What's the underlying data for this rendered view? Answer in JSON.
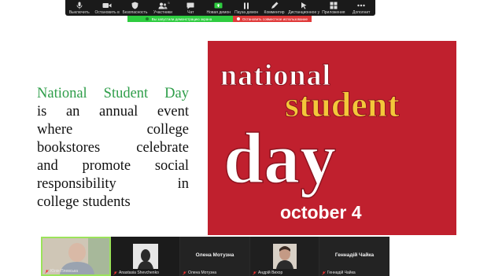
{
  "toolbar": {
    "items": [
      {
        "label": "Выключить",
        "icon": "microphone-icon"
      },
      {
        "label": "Остановить в",
        "icon": "video-camera-icon"
      },
      {
        "label": "Безопасность",
        "icon": "shield-icon"
      },
      {
        "label": "Участники",
        "icon": "participants-icon",
        "count": "5"
      },
      {
        "label": "Чат",
        "icon": "chat-icon"
      },
      {
        "label": "Новая демон",
        "icon": "share-screen-icon"
      },
      {
        "label": "Пауза демон",
        "icon": "pause-icon"
      },
      {
        "label": "Комментир",
        "icon": "annotate-icon"
      },
      {
        "label": "Дистанционное у",
        "icon": "remote-control-icon"
      },
      {
        "label": "Приложения",
        "icon": "apps-icon"
      },
      {
        "label": "Дополнит",
        "icon": "more-icon"
      }
    ]
  },
  "share_banner": {
    "status": "Вы запустили демонстрацию экрана",
    "stop": "Остановить совместное использование"
  },
  "slide": {
    "lines": [
      "National Student Day",
      "is an annual event",
      "where college",
      "bookstores celebrate",
      "and promote social",
      "responsibility in",
      "college students"
    ],
    "lead_color": "#2f9e4a"
  },
  "poster": {
    "word1": "national",
    "word2": "student",
    "word3": "day",
    "date": "october 4",
    "bg_color": "#c0202e",
    "accent_color": "#f3c73a"
  },
  "participants": [
    {
      "name": "Юлія Плевська",
      "video": true
    },
    {
      "name": "Anastasia Shevchenko",
      "video": true
    },
    {
      "name": "Олена Мотузна",
      "video": false,
      "display": "Олена Мотузна"
    },
    {
      "name": "Андрій Вихор",
      "video": true
    },
    {
      "name": "Геннадій Чайка",
      "video": false,
      "display": "Геннадій Чайка"
    }
  ]
}
